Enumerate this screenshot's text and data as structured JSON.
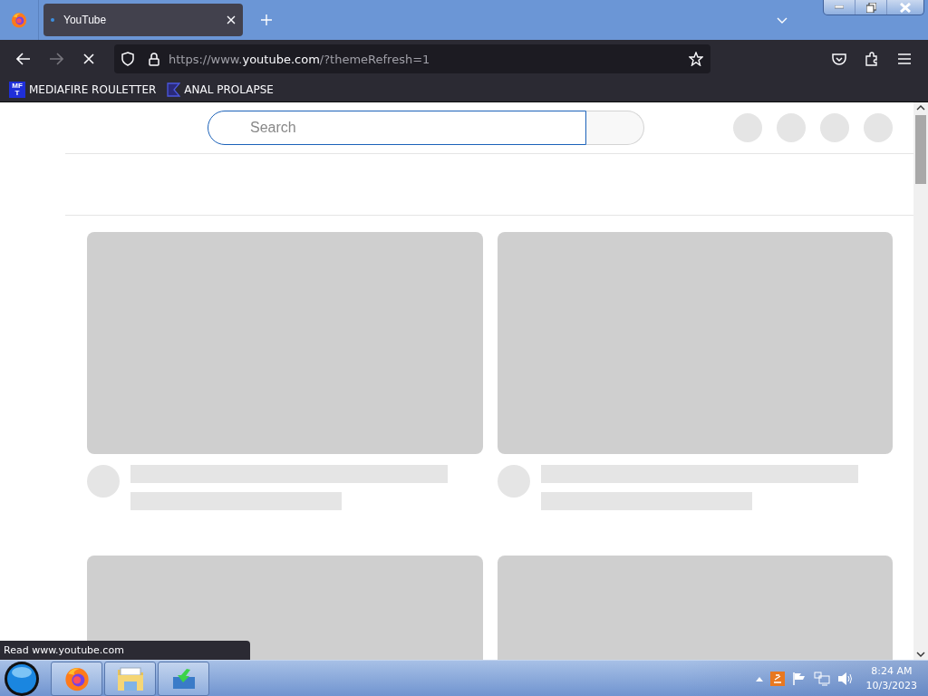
{
  "browser": {
    "tabs": [
      {
        "title": "YouTube",
        "selected": true
      }
    ],
    "url": {
      "prefix": "https://www.",
      "host": "youtube.com",
      "suffix": "/?themeRefresh=1"
    },
    "bookmarks": [
      {
        "label": "MEDIAFIRE ROULETTER",
        "icon_text": "MF T"
      },
      {
        "label": "ANAL PROLAPSE"
      }
    ]
  },
  "page": {
    "search": {
      "placeholder": "Search"
    },
    "video_placeholders": [
      {
        "kind": "skeleton"
      },
      {
        "kind": "skeleton"
      },
      {
        "kind": "thumbnail"
      },
      {
        "kind": "thumbnail"
      }
    ]
  },
  "status_text": "Read www.youtube.com",
  "taskbar": {
    "time": "8:24 AM",
    "date": "10/3/2023"
  }
}
